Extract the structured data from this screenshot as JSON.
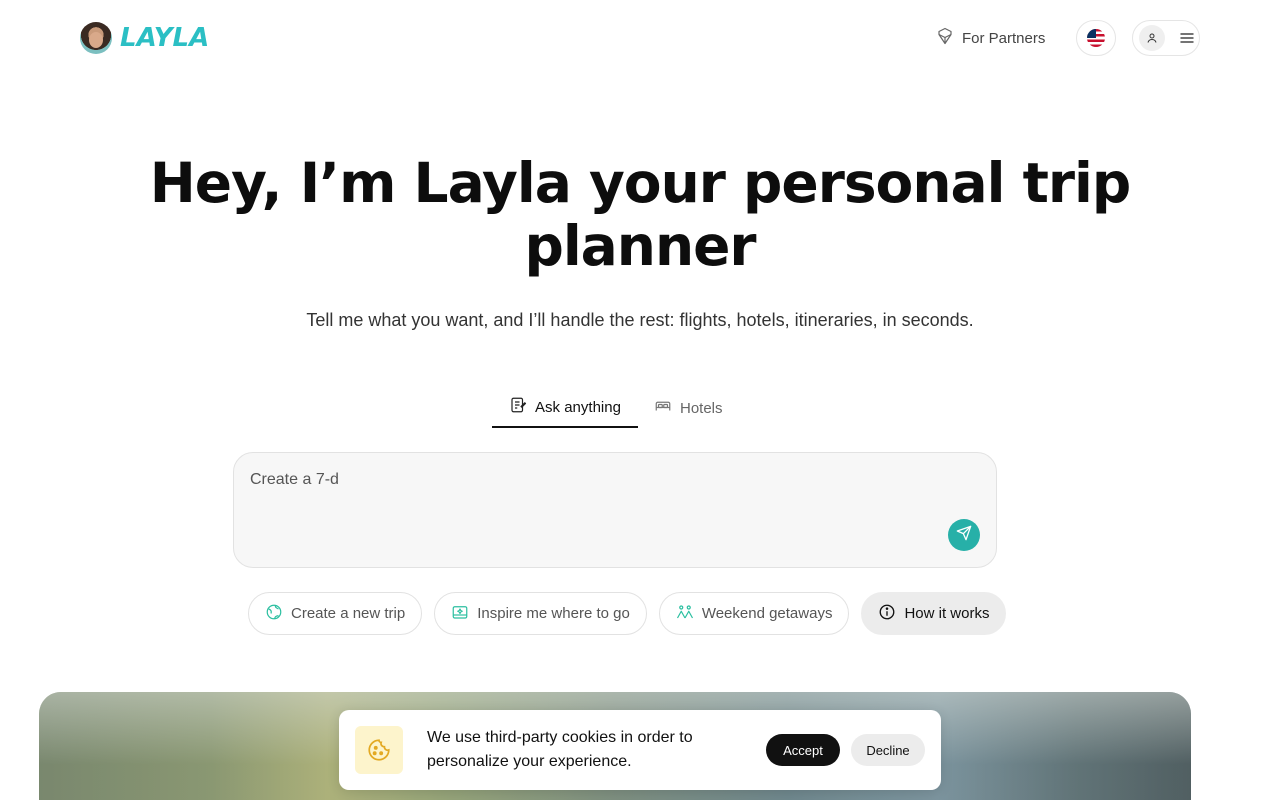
{
  "header": {
    "logo_text": "LAYLA",
    "partners_label": "For Partners",
    "locale_flag": "us-flag-icon"
  },
  "hero": {
    "title": "Hey, I’m Layla your personal trip planner",
    "subtitle": "Tell me what you want, and I’ll handle the rest: flights, hotels, itineraries, in seconds."
  },
  "tabs": [
    {
      "label": "Ask anything",
      "icon": "notepad-icon",
      "active": true
    },
    {
      "label": "Hotels",
      "icon": "bed-icon",
      "active": false
    }
  ],
  "prompt": {
    "value": "Create a 7-d",
    "placeholder": ""
  },
  "chips": [
    {
      "label": "Create a new trip",
      "icon": "globe-icon"
    },
    {
      "label": "Inspire me where to go",
      "icon": "sparkle-map-icon"
    },
    {
      "label": "Weekend getaways",
      "icon": "mountain-people-icon"
    },
    {
      "label": "How it works",
      "icon": "info-icon"
    }
  ],
  "cookie": {
    "message": "We use third-party cookies in order to personalize your experience.",
    "accept_label": "Accept",
    "decline_label": "Decline"
  },
  "colors": {
    "brand": "#2bbfc4",
    "send_button": "#27b0a8",
    "cookie_icon_bg": "#fdf4cc"
  }
}
